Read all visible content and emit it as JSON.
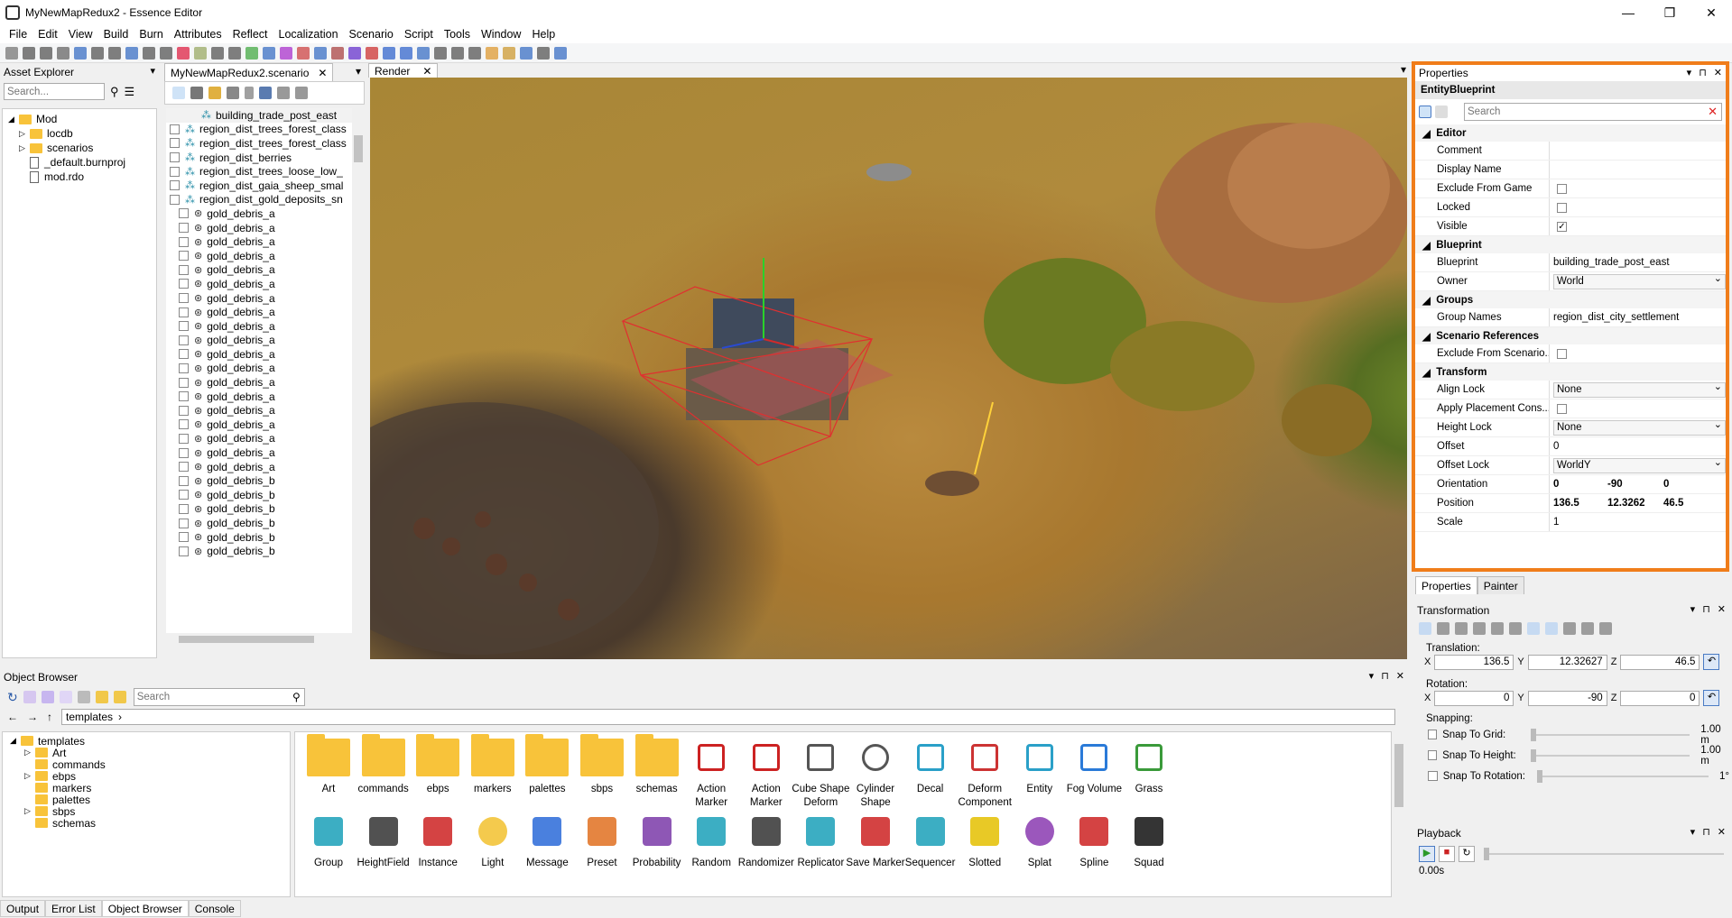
{
  "window": {
    "title": "MyNewMapRedux2 - Essence Editor"
  },
  "menu": [
    "File",
    "Edit",
    "View",
    "Build",
    "Burn",
    "Attributes",
    "Reflect",
    "Localization",
    "Scenario",
    "Script",
    "Tools",
    "Window",
    "Help"
  ],
  "asset_explorer": {
    "title": "Asset Explorer",
    "search_placeholder": "Search...",
    "items": [
      {
        "label": "Mod",
        "type": "folder",
        "depth": 0
      },
      {
        "label": "locdb",
        "type": "folder",
        "depth": 1
      },
      {
        "label": "scenarios",
        "type": "folder",
        "depth": 1
      },
      {
        "label": "_default.burnproj",
        "type": "file",
        "depth": 1
      },
      {
        "label": "mod.rdo",
        "type": "file",
        "depth": 1
      }
    ]
  },
  "scenario_panel": {
    "tab": "MyNewMapRedux2.scenario",
    "items": [
      "building_trade_post_east",
      "region_dist_trees_forest_class",
      "region_dist_trees_forest_class",
      "region_dist_berries",
      "region_dist_trees_loose_low_",
      "region_dist_gaia_sheep_smal",
      "region_dist_gold_deposits_sn",
      "gold_debris_a",
      "gold_debris_a",
      "gold_debris_a",
      "gold_debris_a",
      "gold_debris_a",
      "gold_debris_a",
      "gold_debris_a",
      "gold_debris_a",
      "gold_debris_a",
      "gold_debris_a",
      "gold_debris_a",
      "gold_debris_a",
      "gold_debris_a",
      "gold_debris_a",
      "gold_debris_a",
      "gold_debris_a",
      "gold_debris_a",
      "gold_debris_a",
      "gold_debris_a",
      "gold_debris_b",
      "gold_debris_b",
      "gold_debris_b",
      "gold_debris_b",
      "gold_debris_b",
      "gold_debris_b"
    ]
  },
  "render": {
    "tab": "Render"
  },
  "properties": {
    "title": "Properties",
    "type_name": "EntityBlueprint",
    "search_placeholder": "Search",
    "editor_cat": "Editor",
    "comment": "Comment",
    "display_name": "Display Name",
    "exclude": "Exclude From Game",
    "locked": "Locked",
    "visible": "Visible",
    "blueprint_cat": "Blueprint",
    "blueprint": "Blueprint",
    "blueprint_val": "building_trade_post_east",
    "owner": "Owner",
    "owner_val": "World",
    "groups_cat": "Groups",
    "group_names": "Group Names",
    "group_names_val": "region_dist_city_settlement",
    "scenario_cat": "Scenario References",
    "exclude_scenario": "Exclude From Scenario...",
    "transform_cat": "Transform",
    "align_lock": "Align Lock",
    "align_lock_val": "None",
    "apply_place": "Apply Placement Cons...",
    "height_lock": "Height Lock",
    "height_lock_val": "None",
    "offset": "Offset",
    "offset_val": "0",
    "offset_lock": "Offset Lock",
    "offset_lock_val": "WorldY",
    "orientation": "Orientation",
    "orient_x": "0",
    "orient_y": "-90",
    "orient_z": "0",
    "position": "Position",
    "pos_x": "136.5",
    "pos_y": "12.3262",
    "pos_z": "46.5",
    "scale": "Scale",
    "scale_val": "1",
    "tabs": [
      "Properties",
      "Painter"
    ],
    "accent": "#f07d1a"
  },
  "transformation": {
    "title": "Transformation",
    "translation": "Translation:",
    "tx": "136.5",
    "ty": "12.32627",
    "tz": "46.5",
    "rotation": "Rotation:",
    "rx": "0",
    "ry": "-90",
    "rz": "0",
    "snapping": "Snapping:",
    "snap_grid": "Snap To Grid:",
    "snap_grid_val": "1.00 m",
    "snap_height": "Snap To Height:",
    "snap_height_val": "1.00 m",
    "snap_rot": "Snap To Rotation:",
    "snap_rot_val": "1°",
    "x": "X",
    "y": "Y",
    "z": "Z"
  },
  "playback": {
    "title": "Playback",
    "time": "0.00s"
  },
  "object_browser": {
    "title": "Object Browser",
    "search_placeholder": "Search",
    "path": "templates",
    "tree": [
      {
        "label": "templates",
        "depth": 0
      },
      {
        "label": "Art",
        "depth": 1
      },
      {
        "label": "commands",
        "depth": 1
      },
      {
        "label": "ebps",
        "depth": 1
      },
      {
        "label": "markers",
        "depth": 1
      },
      {
        "label": "palettes",
        "depth": 1
      },
      {
        "label": "sbps",
        "depth": 1
      },
      {
        "label": "schemas",
        "depth": 1
      }
    ],
    "row1": [
      "Art",
      "commands",
      "ebps",
      "markers",
      "palettes",
      "sbps",
      "schemas",
      "Action Marker",
      "Action Marker",
      "Cube Shape Deform",
      "Cylinder Shape",
      "Decal",
      "Deform Component",
      "Entity",
      "Fog Volume",
      "Grass"
    ],
    "row2": [
      "Group",
      "HeightField",
      "Instance",
      "Light",
      "Message",
      "Preset",
      "Probability",
      "Random",
      "Randomizer",
      "Replicator",
      "Save Marker",
      "Sequencer",
      "Slotted",
      "Splat",
      "Spline",
      "Squad"
    ]
  },
  "bottom_tabs": [
    "Output",
    "Error List",
    "Object Browser",
    "Console"
  ]
}
